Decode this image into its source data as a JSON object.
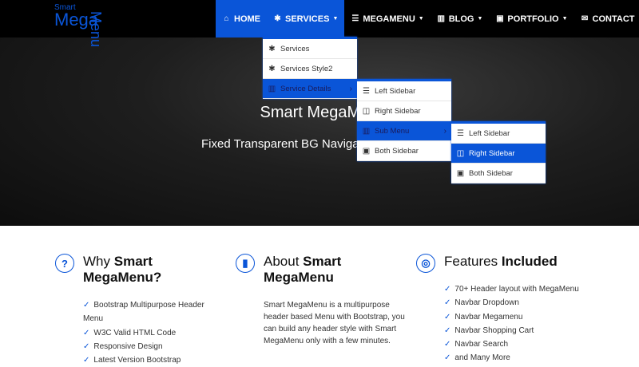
{
  "logo": {
    "top": "Smart",
    "main": "Mega",
    "vertical": "Menu"
  },
  "nav": [
    {
      "label": "HOME",
      "icon": "home-icon",
      "glyph": "⌂"
    },
    {
      "label": "SERVICES",
      "icon": "gear-icon",
      "glyph": "✱"
    },
    {
      "label": "MEGAMENU",
      "icon": "bars-icon",
      "glyph": "☰"
    },
    {
      "label": "BLOG",
      "icon": "book-icon",
      "glyph": "▥"
    },
    {
      "label": "PORTFOLIO",
      "icon": "briefcase-icon",
      "glyph": "▣"
    },
    {
      "label": "CONTACT",
      "icon": "envelope-icon",
      "glyph": "✉"
    }
  ],
  "dropdown1": [
    "Services",
    "Services Style2",
    "Service Details"
  ],
  "dropdown2": [
    "Left Sidebar",
    "Right Sidebar",
    "Sub Menu",
    "Both Sidebar"
  ],
  "dropdown3": [
    "Left Sidebar",
    "Right Sidebar",
    "Both Sidebar"
  ],
  "hero": {
    "title": "Smart MegaMenu",
    "subtitle": "Fixed Transparent BG Navigation"
  },
  "why": {
    "title_a": "Why ",
    "title_b": "Smart MegaMenu?",
    "items": [
      "Bootstrap Multipurpose Header Menu",
      "W3C Valid HTML Code",
      "Responsive Design",
      "Latest Version Bootstrap"
    ]
  },
  "about": {
    "title_a": "About ",
    "title_b": "Smart MegaMenu",
    "text": "Smart MegaMenu is a multipurpose header based Menu with Bootstrap, you can build any header style with Smart MegaMenu only with a few minutes."
  },
  "features": {
    "title_a": "Features ",
    "title_b": "Included",
    "items": [
      "70+ Header layout with MegaMenu",
      "Navbar Dropdown",
      "Navbar Megamenu",
      "Navbar Shopping Cart",
      "Navbar Search",
      "and Many More"
    ]
  }
}
